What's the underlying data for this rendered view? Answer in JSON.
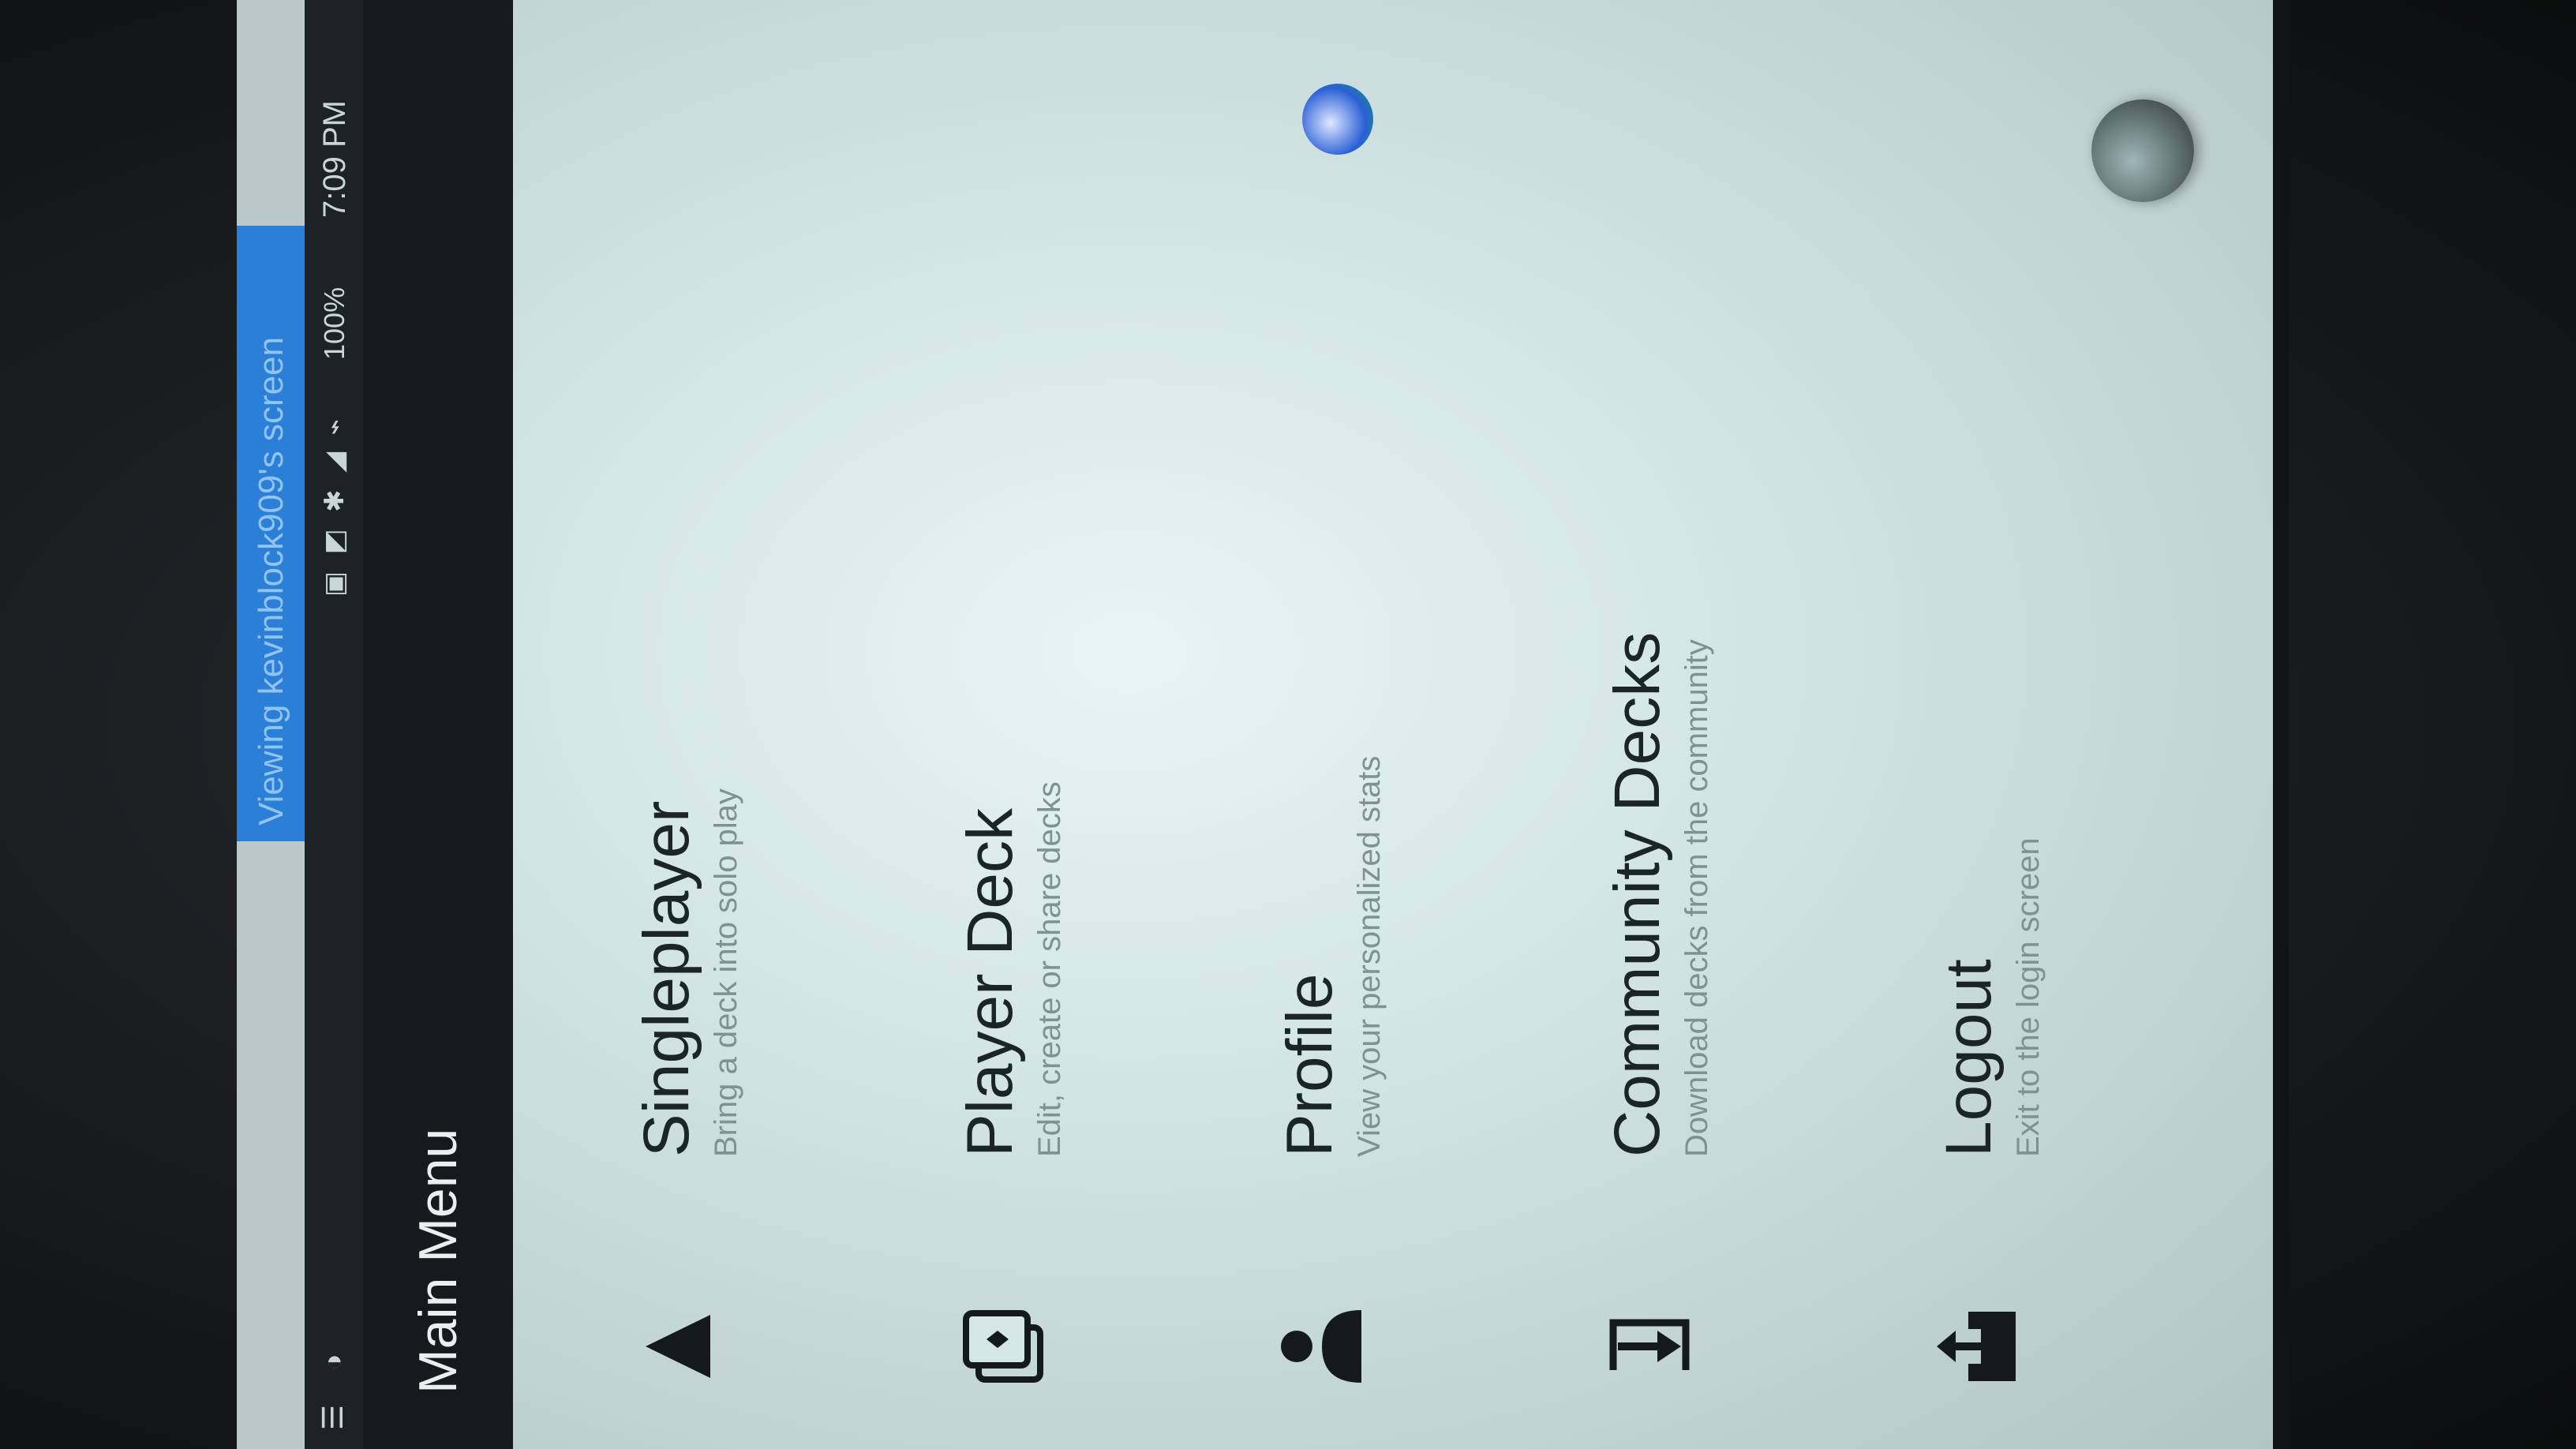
{
  "cast_banner": {
    "text": "Viewing kevinblock909's screen"
  },
  "status_bar": {
    "icons": "▣ ◩ ✱ ◢ ⌁",
    "battery": "100%",
    "time": "7:09 PM"
  },
  "app_bar": {
    "title": "Main Menu"
  },
  "menu": [
    {
      "title": "Singleplayer",
      "subtitle": "Bring a deck into solo play",
      "icon": "play-triangle-icon"
    },
    {
      "title": "Player Deck",
      "subtitle": "Edit, create or share decks",
      "icon": "cards-icon"
    },
    {
      "title": "Profile",
      "subtitle": "View your personalized stats",
      "icon": "person-icon"
    },
    {
      "title": "Community Decks",
      "subtitle": "Download decks from the community",
      "icon": "login-arrow-icon"
    },
    {
      "title": "Logout",
      "subtitle": "Exit to the login screen",
      "icon": "export-icon"
    }
  ],
  "colors": {
    "accent_blue": "#2c7fd6",
    "content_bg": "#d5e6e6",
    "text_primary": "#1b2527",
    "text_secondary": "#7f9193"
  }
}
